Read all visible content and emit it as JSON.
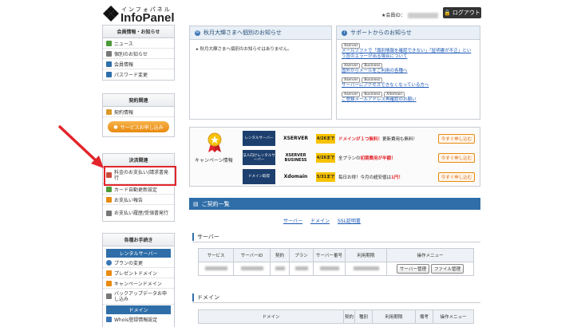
{
  "header": {
    "logo_sub": "インフォパネル",
    "logo_main": "InfoPanel",
    "member_id_label": "★会員ID：",
    "logout_label": "ログアウト"
  },
  "sidebar": {
    "member_info": {
      "title": "会員情報・お知らせ",
      "items": [
        {
          "label": "ニュース",
          "color": "#4e9a3a"
        },
        {
          "label": "個別のお知らせ",
          "color": "#777777"
        },
        {
          "label": "会員情報",
          "color": "#2f6ea8"
        },
        {
          "label": "パスワード変更",
          "color": "#2f6ea8"
        }
      ]
    },
    "contract": {
      "title": "契約関連",
      "items": [
        {
          "label": "契約情報",
          "color": "#d99a2b"
        }
      ],
      "service_apply": "サービスお申し込み"
    },
    "billing": {
      "title": "決済関連",
      "items": [
        {
          "label": "料金のお支払い/請求書発行",
          "color": "#c94a3a"
        },
        {
          "label": "カード自動更新設定",
          "color": "#4e9a3a"
        },
        {
          "label": "お支払い報告",
          "color": "#e98a10"
        },
        {
          "label": "お支払い履歴/受領書発行",
          "color": "#777777"
        }
      ]
    },
    "procedures": {
      "title": "各種お手続き",
      "rental_title": "レンタルサーバー",
      "items": [
        {
          "label": "プランの変更",
          "color": "#3a76b5"
        },
        {
          "label": "プレゼントドメイン",
          "color": "#e98a10"
        },
        {
          "label": "キャンペーンドメイン",
          "color": "#e98a10"
        },
        {
          "label": "バックアップデータお申し込み",
          "color": "#777777"
        }
      ],
      "domain_title": "ドメイン",
      "domain_items": [
        {
          "label": "Whois登録情報設定",
          "color": "#3a76b5"
        }
      ]
    }
  },
  "personal_notice": {
    "title": "秋月大輝さまへ個別のお知らせ",
    "body": "秋月大輝さまへ個別のお知らせはありません。"
  },
  "support_notice": {
    "title": "サポートからのお知らせ",
    "entries": [
      {
        "tags": [
          "Xserver"
        ],
        "text": "メールソフトで「識別情報を確認できない」「証明書が不正」という旨のエラーが出る場合について"
      },
      {
        "tags": [
          "Xserver",
          "Business"
        ],
        "text": "国外からメールをご利用の各種へ"
      },
      {
        "tags": [
          "Xserver",
          "Business"
        ],
        "text": "サーバーにアクセスできなくなっている方へ"
      },
      {
        "tags": [
          "Xserver",
          "Business",
          "Xdomain"
        ],
        "text": "ご登録メールアドレス再確認のお願い"
      }
    ]
  },
  "campaign": {
    "label": "キャンペーン情報",
    "rows": [
      {
        "category": "レンタルサーバー",
        "brand": "XSERVER",
        "date": "4/26まで",
        "text_red": "ドメインが１つ無料！",
        "text": "更新費用も無料！",
        "button": "今すぐ申し込む"
      },
      {
        "category": "法人向けレンタルサーバー",
        "brand": "XSERVER BUSINESS",
        "date": "4/26まで",
        "text_pre": "全プランの",
        "text_red": "初期費用が半額！",
        "text": "",
        "button": "今すぐ申し込む"
      },
      {
        "category": "ドメイン取得",
        "brand": "Xdomain",
        "date": "5/31まで",
        "text_pre": "毎日お得！今月の超安値は",
        "text_red": "1円！",
        "text": "",
        "button": "今すぐ申し込む"
      }
    ]
  },
  "contracts": {
    "section_title": "ご契約一覧",
    "nav": [
      "サーバー",
      "ドメイン",
      "SSL証明書"
    ],
    "server": {
      "title": "サーバー",
      "headers": [
        "サービス",
        "サーバーID",
        "契約",
        "プラン",
        "サーバー番号",
        "利用期限",
        "操作メニュー"
      ],
      "buttons": [
        "サーバー管理",
        "ファイル管理"
      ]
    },
    "domain": {
      "title": "ドメイン",
      "headers": [
        "ドメイン",
        "契約",
        "種別",
        "利用期限",
        "備考",
        "操作メニュー"
      ]
    }
  },
  "annotation": {
    "arrow_color": "#e2252b"
  }
}
